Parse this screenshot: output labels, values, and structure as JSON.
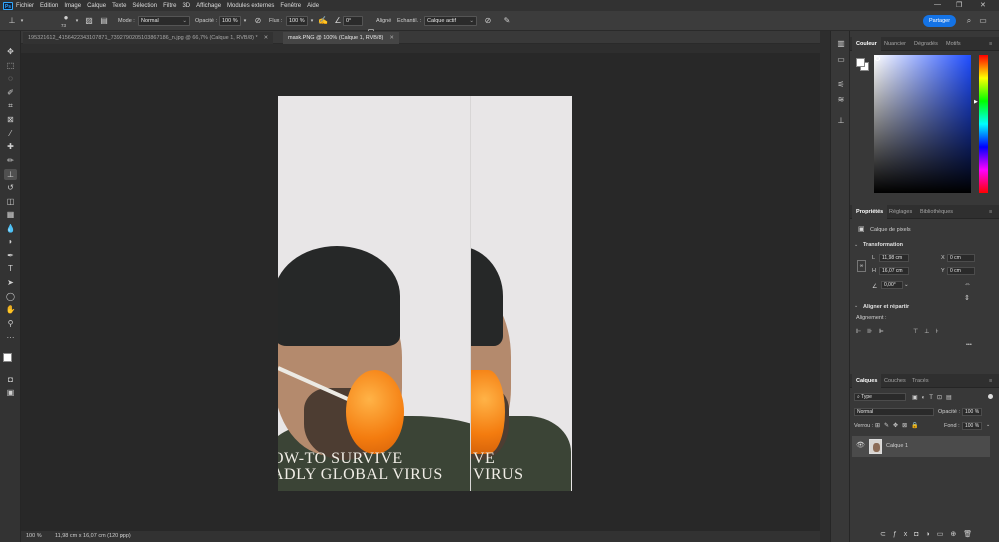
{
  "menubar": {
    "items": [
      "Fichier",
      "Edition",
      "Image",
      "Calque",
      "Texte",
      "Sélection",
      "Filtre",
      "3D",
      "Affichage",
      "Modules externes",
      "Fenêtre",
      "Aide"
    ],
    "logo": "Ps",
    "window_controls": [
      "—",
      "❐",
      "✕"
    ]
  },
  "options": {
    "brush_size": "73",
    "mode_label": "Mode :",
    "mode_value": "Normal",
    "opacity_label": "Opacité :",
    "opacity_value": "100 %",
    "flow_label": "Flux :",
    "flow_value": "100 %",
    "angle_value": "0°",
    "aligned_label": "Aligné",
    "sample_label": "Echantil. :",
    "sample_value": "Calque actif",
    "share_label": "Partager"
  },
  "tabs": [
    {
      "label": "195321612_4156422343107871_7392790205103867186_n.jpg @ 66,7% (Calque 1, RVB/8) *"
    },
    {
      "label": "mask.PNG @ 100% (Calque 1, RVB/8)"
    }
  ],
  "status": {
    "zoom": "100 %",
    "doc_size": "11,98 cm x 16,07 cm (120 ppp)"
  },
  "document": {
    "headline_line1": "OW-TO SURVIVE",
    "headline_line2": "ADLY GLOBAL VIRUS",
    "right_line1": "VE",
    "right_line2": "VIRUS"
  },
  "color_panel": {
    "tabs": [
      "Couleur",
      "Nuancier",
      "Dégradés",
      "Motifs"
    ],
    "hue_colors": [
      "#ff0000",
      "#ffff00",
      "#00ff00",
      "#00ffff",
      "#0000ff",
      "#ff00ff",
      "#ff0000"
    ],
    "base_color": "#1f4dff"
  },
  "properties": {
    "tabs": [
      "Propriétés",
      "Réglages",
      "Bibliothèques"
    ],
    "layer_type": "Calque de pixels",
    "transform_title": "Transformation",
    "L_label": "L",
    "L_value": "11,98 cm",
    "H_label": "H",
    "H_value": "16,07 cm",
    "X_label": "X",
    "X_value": "0 cm",
    "Y_label": "Y",
    "Y_value": "0 cm",
    "angle_value": "0,00°",
    "align_title": "Aligner et répartir",
    "align_label": "Alignement :",
    "more": "•••"
  },
  "layers": {
    "tabs": [
      "Calques",
      "Couches",
      "Tracés"
    ],
    "filter_value": "Type",
    "blend_value": "Normal",
    "opacity_label": "Opacité :",
    "opacity_value": "100 %",
    "lock_label": "Verrou :",
    "fill_label": "Fond :",
    "fill_value": "100 %",
    "layer_name": "Calque 1"
  }
}
